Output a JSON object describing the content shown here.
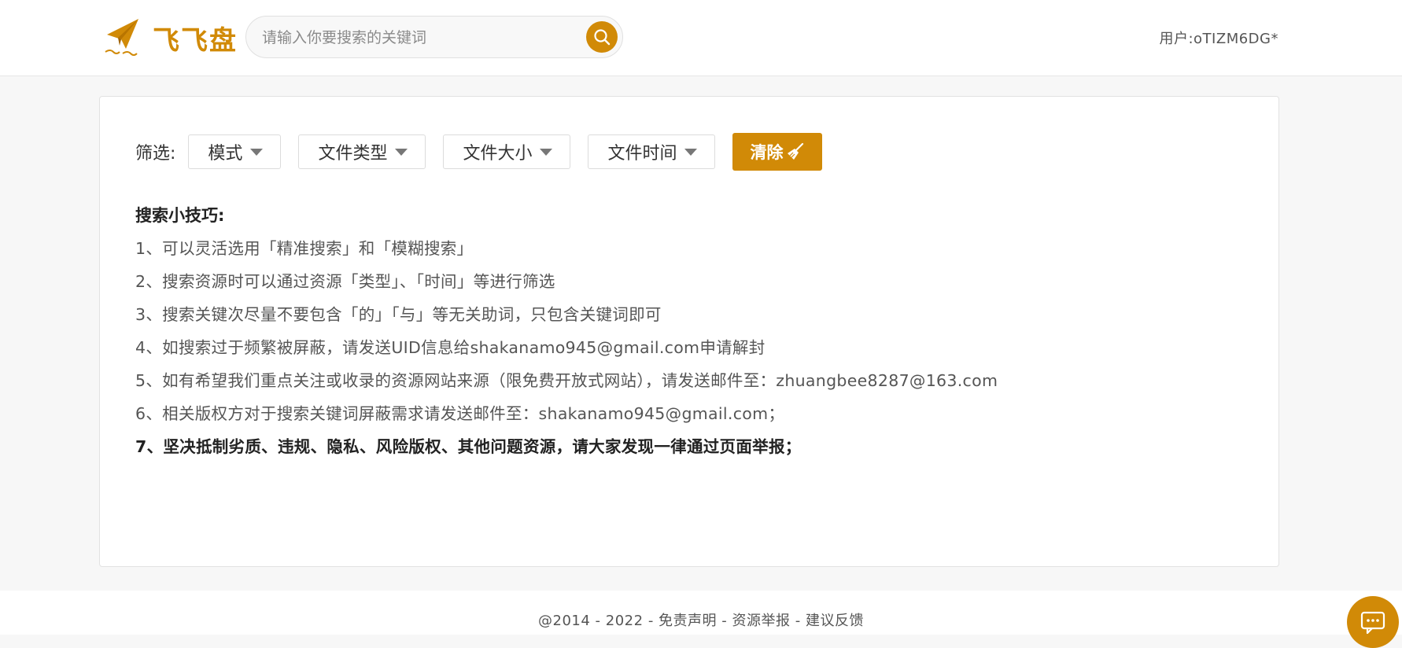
{
  "header": {
    "logo_text": "飞飞盘",
    "search_placeholder": "请输入你要搜索的关键词",
    "user_label": "用户:oTIZM6DG*"
  },
  "filters": {
    "label": "筛选:",
    "mode": "模式",
    "file_type": "文件类型",
    "file_size": "文件大小",
    "file_time": "文件时间",
    "clear": "清除"
  },
  "tips": {
    "title": "搜索小技巧:",
    "items": [
      "1、可以灵活选用「精准搜索」和「模糊搜索」",
      "2、搜索资源时可以通过资源「类型」、「时间」等进行筛选",
      "3、搜索关键次尽量不要包含「的」「与」等无关助词，只包含关键词即可",
      "4、如搜索过于频繁被屏蔽，请发送UID信息给shakanamo945@gmail.com申请解封",
      "5、如有希望我们重点关注或收录的资源网站来源（限免费开放式网站），请发送邮件至：zhuangbee8287@163.com",
      "6、相关版权方对于搜索关键词屏蔽需求请发送邮件至：shakanamo945@gmail.com；",
      "7、坚决抵制劣质、违规、隐私、风险版权、其他问题资源，请大家发现一律通过页面举报；"
    ]
  },
  "footer": {
    "copyright": "@2014 - 2022",
    "sep1": " - ",
    "disclaimer": "免责声明",
    "sep2": " - ",
    "report": "资源举报",
    "sep3": " - ",
    "feedback": "建议反馈"
  },
  "colors": {
    "accent": "#d18a07"
  }
}
